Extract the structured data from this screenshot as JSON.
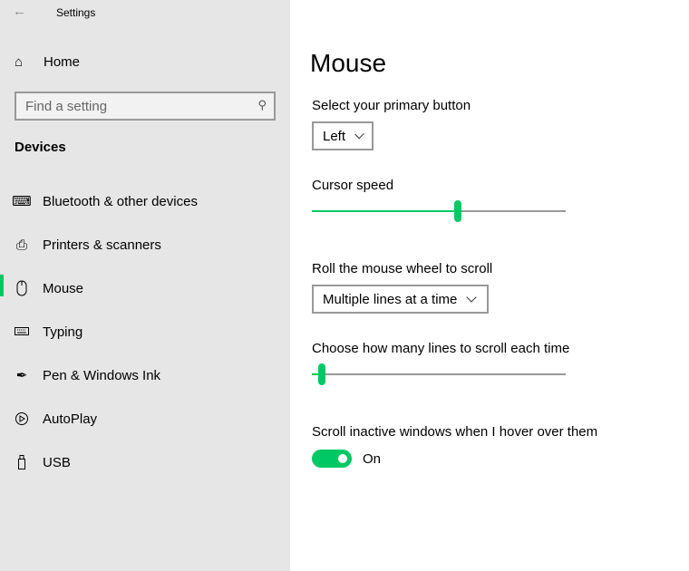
{
  "window": {
    "title": "Settings"
  },
  "sidebar": {
    "home_label": "Home",
    "search_placeholder": "Find a setting",
    "section": "Devices",
    "items": [
      {
        "label": "Bluetooth & other devices",
        "icon": "bluetooth-devices-icon"
      },
      {
        "label": "Printers & scanners",
        "icon": "printer-icon"
      },
      {
        "label": "Mouse",
        "icon": "mouse-icon",
        "active": true
      },
      {
        "label": "Typing",
        "icon": "keyboard-icon"
      },
      {
        "label": "Pen & Windows Ink",
        "icon": "pen-icon"
      },
      {
        "label": "AutoPlay",
        "icon": "autoplay-icon"
      },
      {
        "label": "USB",
        "icon": "usb-icon"
      }
    ]
  },
  "main": {
    "title": "Mouse",
    "primary_button": {
      "label": "Select your primary button",
      "value": "Left"
    },
    "cursor_speed": {
      "label": "Cursor speed",
      "fraction": 0.575
    },
    "wheel_scroll": {
      "label": "Roll the mouse wheel to scroll",
      "value": "Multiple lines at a time"
    },
    "lines_scroll": {
      "label": "Choose how many lines to scroll each time",
      "fraction": 0.04
    },
    "inactive_scroll": {
      "label": "Scroll inactive windows when I hover over them",
      "state": "On",
      "on": true
    }
  },
  "colors": {
    "accent": "#00c864",
    "sidebar_bg": "#e6e6e6"
  }
}
